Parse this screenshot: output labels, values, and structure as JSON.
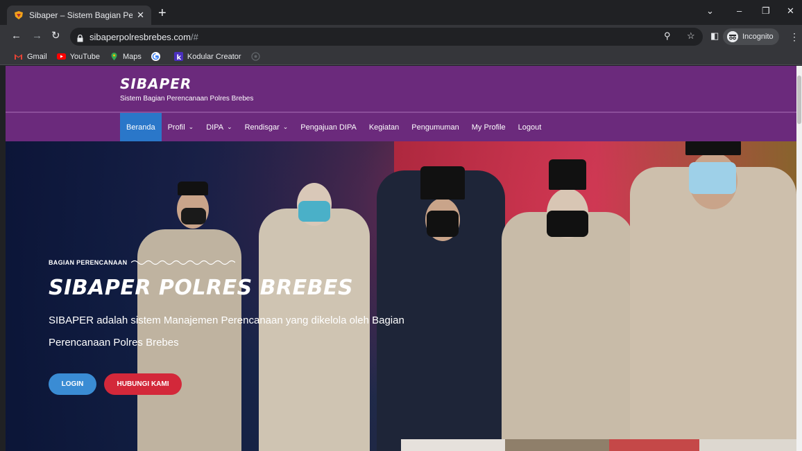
{
  "browser": {
    "tab_title": "Sibaper – Sistem Bagian Perencan",
    "url_host": "sibaperpolresbrebes.com",
    "url_path": "/#",
    "incognito_label": "Incognito",
    "bookmarks": [
      {
        "label": "Gmail",
        "icon": "gmail-icon"
      },
      {
        "label": "YouTube",
        "icon": "youtube-icon"
      },
      {
        "label": "Maps",
        "icon": "maps-icon"
      },
      {
        "label": "",
        "icon": "google-icon"
      },
      {
        "label": "Kodular Creator",
        "icon": "kodular-icon"
      }
    ]
  },
  "site": {
    "logo": "SIBAPER",
    "tagline": "Sistem Bagian Perencanaan Polres Brebes",
    "nav": [
      {
        "label": "Beranda",
        "active": true,
        "dropdown": false
      },
      {
        "label": "Profil",
        "active": false,
        "dropdown": true
      },
      {
        "label": "DIPA",
        "active": false,
        "dropdown": true
      },
      {
        "label": "Rendisgar",
        "active": false,
        "dropdown": true
      },
      {
        "label": "Pengajuan DIPA",
        "active": false,
        "dropdown": false
      },
      {
        "label": "Kegiatan",
        "active": false,
        "dropdown": false
      },
      {
        "label": "Pengumuman",
        "active": false,
        "dropdown": false
      },
      {
        "label": "My Profile",
        "active": false,
        "dropdown": false
      },
      {
        "label": "Logout",
        "active": false,
        "dropdown": false
      }
    ],
    "colors": {
      "header": "#6b2a7c",
      "nav_active": "#2a77c9",
      "login_button": "#3a8cd4",
      "contact_button": "#d3283a"
    }
  },
  "hero": {
    "eyebrow": "BAGIAN PERENCANAAN",
    "title": "SIBAPER POLRES BREBES",
    "description": "SIBAPER adalah sistem Manajemen Perencanaan yang dikelola oleh Bagian Perencanaan Polres Brebes",
    "login_label": "LOGIN",
    "contact_label": "HUBUNGI KAMI"
  }
}
